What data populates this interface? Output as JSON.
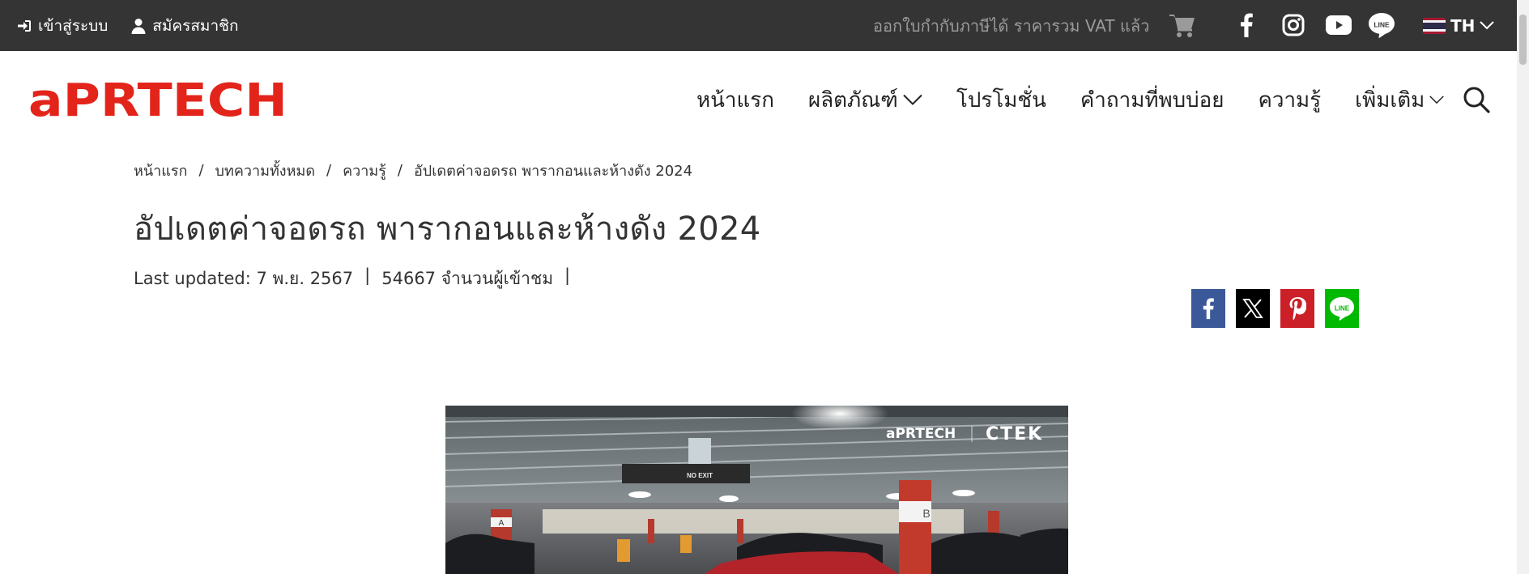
{
  "topbar": {
    "login_label": "เข้าสู่ระบบ",
    "register_label": "สมัครสมาชิก",
    "vat_text": "ออกใบกำกับภาษีได้ ราคารวม VAT แล้ว",
    "line_icon_text": "LINE",
    "language": "TH"
  },
  "brand": {
    "logo_text": "aPRTECH",
    "accent_color": "#e3241b"
  },
  "nav": {
    "items": [
      {
        "label": "หน้าแรก",
        "has_dropdown": false
      },
      {
        "label": "ผลิตภัณฑ์",
        "has_dropdown": true
      },
      {
        "label": "โปรโมชั่น",
        "has_dropdown": false
      },
      {
        "label": "คำถามที่พบบ่อย",
        "has_dropdown": false
      },
      {
        "label": "ความรู้",
        "has_dropdown": false
      },
      {
        "label": "เพิ่มเติม",
        "has_dropdown": true
      }
    ]
  },
  "breadcrumb": [
    "หน้าแรก",
    "บทความทั้งหมด",
    "ความรู้",
    "อัปเดตค่าจอดรถ พารากอนและห้างดัง 2024"
  ],
  "article": {
    "title": "อัปเดตค่าจอดรถ พารากอนและห้างดัง 2024",
    "last_updated": "Last updated: 7 พ.ย. 2567",
    "views": "54667 จำนวนผู้เข้าชม",
    "separator": "|"
  },
  "share": {
    "line_text": "LINE",
    "colors": {
      "facebook": "#3b5998",
      "x": "#000000",
      "pinterest": "#cb2027",
      "line": "#00b900"
    }
  },
  "hero_image": {
    "watermark_left": "aPRTECH",
    "watermark_right": "CTEK",
    "sign_text": "NO EXIT",
    "pillar_label_a": "A",
    "pillar_label_b": "B"
  }
}
